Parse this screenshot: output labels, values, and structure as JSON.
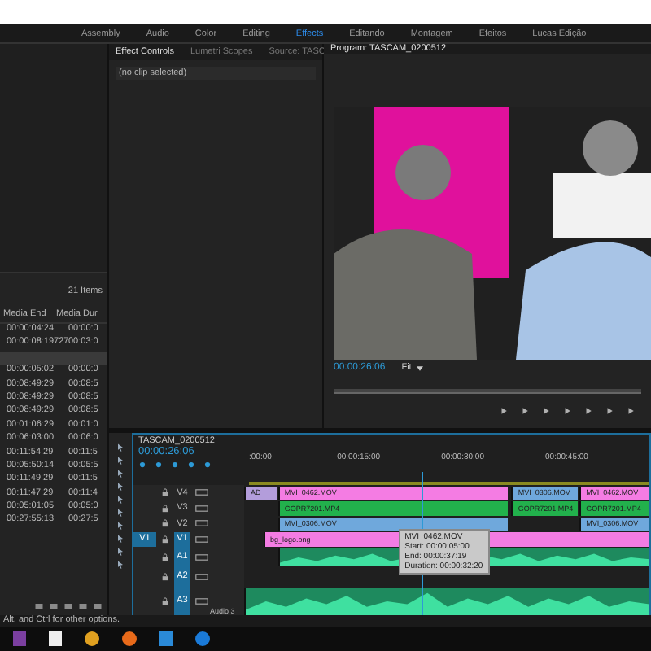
{
  "workspaces": [
    {
      "label": "Assembly",
      "selected": false
    },
    {
      "label": "Audio",
      "selected": false
    },
    {
      "label": "Color",
      "selected": false
    },
    {
      "label": "Editing",
      "selected": false
    },
    {
      "label": "Effects",
      "selected": true
    },
    {
      "label": "Editando",
      "selected": false
    },
    {
      "label": "Montagem",
      "selected": false
    },
    {
      "label": "Efeitos",
      "selected": false
    },
    {
      "label": "Lucas Edição",
      "selected": false
    }
  ],
  "project": {
    "item_count": "21 Items",
    "columns": [
      "Media End",
      "Media Dur"
    ],
    "rows": [
      {
        "cells": [
          "00:00:04:24",
          "00:00:0"
        ],
        "selected": false
      },
      {
        "cells": [
          "00:00:08:19727",
          "00:03:0"
        ],
        "selected": false
      },
      {
        "cells": [],
        "selected": true
      },
      {
        "cells": [
          "00:00:05:02",
          "00:00:0"
        ],
        "selected": false
      },
      {
        "cells": [
          "00:08:49:29",
          "00:08:5"
        ],
        "selected": false
      },
      {
        "cells": [
          "00:08:49:29",
          "00:08:5"
        ],
        "selected": false
      },
      {
        "cells": [
          "00:08:49:29",
          "00:08:5"
        ],
        "selected": false
      },
      {
        "cells": [
          "00:01:06:29",
          "00:01:0"
        ],
        "selected": false
      },
      {
        "cells": [
          "00:06:03:00",
          "00:06:0"
        ],
        "selected": false
      },
      {
        "cells": [
          "00:11:54:29",
          "00:11:5"
        ],
        "selected": false
      },
      {
        "cells": [
          "00:05:50:14",
          "00:05:5"
        ],
        "selected": false
      },
      {
        "cells": [
          "00:11:49:29",
          "00:11:5"
        ],
        "selected": false
      },
      {
        "cells": [
          "00:11:47:29",
          "00:11:4"
        ],
        "selected": false
      },
      {
        "cells": [
          "00:05:01:05",
          "00:05:0"
        ],
        "selected": false
      },
      {
        "cells": [
          "00:27:55:13",
          "00:27:5"
        ],
        "selected": false
      }
    ]
  },
  "effect_controls": {
    "tabs": [
      {
        "label": "Effect Controls",
        "selected": true
      },
      {
        "label": "Lumetri Scopes",
        "selected": false
      },
      {
        "label": "Source: TASC",
        "selected": false
      }
    ],
    "message": "(no clip selected)"
  },
  "program": {
    "title": "Program: TASCAM_0200512",
    "timecode": "00:00:26:06",
    "zoom": "Fit"
  },
  "timeline": {
    "title": "TASCAM_0200512",
    "timecode": "00:00:26:06",
    "ruler": [
      ":00:00",
      "00:00:15:00",
      "00:00:30:00",
      "00:00:45:00"
    ],
    "tracks": [
      {
        "name": "V4",
        "kind": "video",
        "targeted": false,
        "clips": [
          {
            "label": "AD",
            "color": "#b39ddb"
          },
          {
            "label": "MVI_0462.MOV",
            "color": "#f47ce3"
          },
          {
            "label": "MVI_0306.MOV",
            "color": "#6fa8dc"
          },
          {
            "label": "MVI_0462.MOV",
            "color": "#f47ce3"
          }
        ]
      },
      {
        "name": "V3",
        "kind": "video",
        "targeted": false,
        "clips": [
          {
            "label": "GOPR7201.MP4",
            "color": "#22b14c"
          },
          {
            "label": "GOPR7201.MP4",
            "color": "#22b14c"
          },
          {
            "label": "GOPR7201.MP4",
            "color": "#22b14c"
          }
        ]
      },
      {
        "name": "V2",
        "kind": "video",
        "targeted": false,
        "clips": [
          {
            "label": "MVI_0306.MOV",
            "color": "#6fa8dc"
          },
          {
            "label": "MVI_0306.MOV",
            "color": "#6fa8dc"
          }
        ]
      },
      {
        "name": "V1",
        "kind": "video",
        "targeted": true,
        "source": "V1",
        "clips": [
          {
            "label": "bg_logo.png",
            "color": "#f47ce3"
          }
        ]
      },
      {
        "name": "A1",
        "kind": "audio",
        "targeted": true,
        "clips": [
          {
            "color": "#1e8a5e"
          }
        ]
      },
      {
        "name": "A2",
        "kind": "audio",
        "targeted": true
      },
      {
        "name": "A3",
        "kind": "audio",
        "targeted": true,
        "label": "Audio 3",
        "clips": [
          {
            "color": "#1e8a5e"
          }
        ]
      }
    ],
    "tooltip": [
      "MVI_0462.MOV",
      "Start: 00:00:05:00",
      "End: 00:00:37:19",
      "Duration: 00:00:32:20"
    ]
  },
  "status_bar": "Alt, and Ctrl for other options."
}
